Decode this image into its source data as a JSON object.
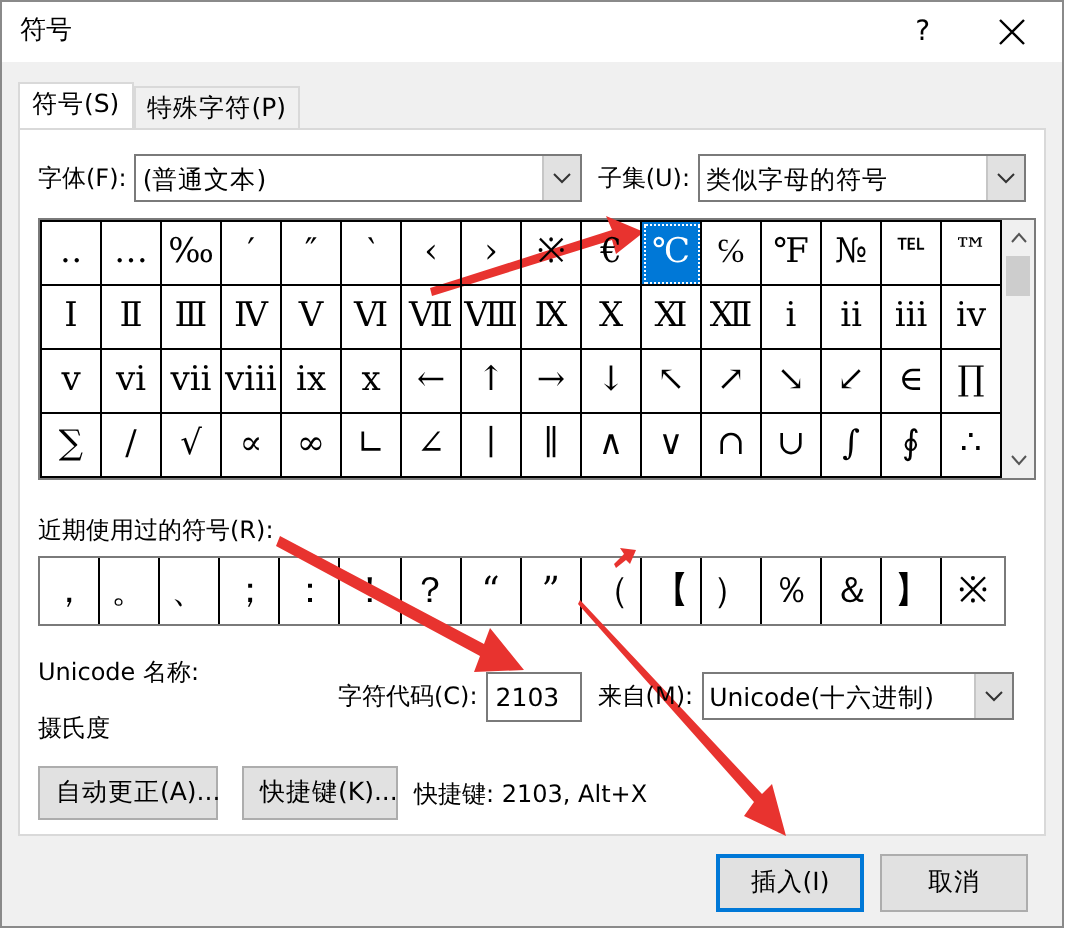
{
  "window": {
    "title": "符号",
    "help": "?"
  },
  "tabs": [
    {
      "label": "符号(S)",
      "selected": true
    },
    {
      "label": "特殊字符(P)",
      "selected": false
    }
  ],
  "font": {
    "label": "字体(F):",
    "value": "(普通文本)"
  },
  "subset": {
    "label": "子集(U):",
    "value": "类似字母的符号"
  },
  "symbols": [
    {
      "char": "‥",
      "selected": false
    },
    {
      "char": "…",
      "selected": false
    },
    {
      "char": "‰",
      "selected": false
    },
    {
      "char": "′",
      "selected": false
    },
    {
      "char": "″",
      "selected": false
    },
    {
      "char": "‵",
      "selected": false
    },
    {
      "char": "‹",
      "selected": false
    },
    {
      "char": "›",
      "selected": false
    },
    {
      "char": "※",
      "selected": false
    },
    {
      "char": "€",
      "selected": false
    },
    {
      "char": "℃",
      "selected": true
    },
    {
      "char": "℅",
      "selected": false
    },
    {
      "char": "℉",
      "selected": false
    },
    {
      "char": "№",
      "selected": false
    },
    {
      "char": "℡",
      "selected": false
    },
    {
      "char": "™",
      "selected": false
    },
    {
      "char": "Ⅰ",
      "selected": false
    },
    {
      "char": "Ⅱ",
      "selected": false
    },
    {
      "char": "Ⅲ",
      "selected": false
    },
    {
      "char": "Ⅳ",
      "selected": false
    },
    {
      "char": "Ⅴ",
      "selected": false
    },
    {
      "char": "Ⅵ",
      "selected": false
    },
    {
      "char": "Ⅶ",
      "selected": false
    },
    {
      "char": "Ⅷ",
      "selected": false
    },
    {
      "char": "Ⅸ",
      "selected": false
    },
    {
      "char": "Ⅹ",
      "selected": false
    },
    {
      "char": "Ⅺ",
      "selected": false
    },
    {
      "char": "Ⅻ",
      "selected": false
    },
    {
      "char": "ⅰ",
      "selected": false
    },
    {
      "char": "ⅱ",
      "selected": false
    },
    {
      "char": "ⅲ",
      "selected": false
    },
    {
      "char": "ⅳ",
      "selected": false
    },
    {
      "char": "ⅴ",
      "selected": false
    },
    {
      "char": "ⅵ",
      "selected": false
    },
    {
      "char": "ⅶ",
      "selected": false
    },
    {
      "char": "ⅷ",
      "selected": false
    },
    {
      "char": "ⅸ",
      "selected": false
    },
    {
      "char": "ⅹ",
      "selected": false
    },
    {
      "char": "←",
      "selected": false
    },
    {
      "char": "↑",
      "selected": false
    },
    {
      "char": "→",
      "selected": false
    },
    {
      "char": "↓",
      "selected": false
    },
    {
      "char": "↖",
      "selected": false
    },
    {
      "char": "↗",
      "selected": false
    },
    {
      "char": "↘",
      "selected": false
    },
    {
      "char": "↙",
      "selected": false
    },
    {
      "char": "∈",
      "selected": false
    },
    {
      "char": "∏",
      "selected": false
    },
    {
      "char": "∑",
      "selected": false
    },
    {
      "char": "∕",
      "selected": false
    },
    {
      "char": "√",
      "selected": false
    },
    {
      "char": "∝",
      "selected": false
    },
    {
      "char": "∞",
      "selected": false
    },
    {
      "char": "∟",
      "selected": false
    },
    {
      "char": "∠",
      "selected": false
    },
    {
      "char": "∣",
      "selected": false
    },
    {
      "char": "∥",
      "selected": false
    },
    {
      "char": "∧",
      "selected": false
    },
    {
      "char": "∨",
      "selected": false
    },
    {
      "char": "∩",
      "selected": false
    },
    {
      "char": "∪",
      "selected": false
    },
    {
      "char": "∫",
      "selected": false
    },
    {
      "char": "∮",
      "selected": false
    },
    {
      "char": "∴",
      "selected": false
    }
  ],
  "recent_label": "近期使用过的符号(R):",
  "recent": [
    "，",
    "。",
    "、",
    "；",
    "：",
    "！",
    "？",
    "“",
    "”",
    "（",
    "【",
    "）",
    "％",
    "＆",
    "】",
    "※"
  ],
  "unicode_name_label": "Unicode 名称:",
  "unicode_name": "摄氏度",
  "char_code": {
    "label": "字符代码(C):",
    "value": "2103"
  },
  "from": {
    "label": "来自(M):",
    "value": "Unicode(十六进制)"
  },
  "autocorrect_button": "自动更正(A)...",
  "shortcut_button": "快捷键(K)...",
  "shortcut_text": "快捷键: 2103, Alt+X",
  "insert_button": "插入(I)",
  "cancel_button": "取消"
}
